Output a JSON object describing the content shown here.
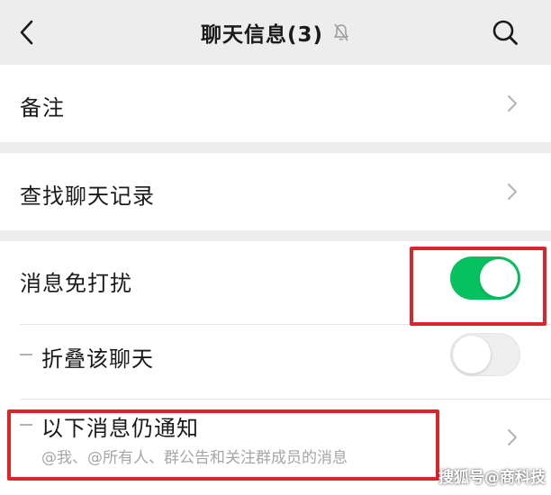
{
  "header": {
    "title": "聊天信息(3)",
    "back_icon": "chevron-left-icon",
    "mute_icon": "bell-muted-icon",
    "search_icon": "search-icon"
  },
  "rows": {
    "remark": {
      "label": "备注"
    },
    "find_history": {
      "label": "查找聊天记录"
    },
    "do_not_disturb": {
      "label": "消息免打扰",
      "enabled": true
    },
    "fold_chat": {
      "label": "折叠该聊天",
      "enabled": false
    },
    "still_notify": {
      "label": "以下消息仍通知",
      "description": "@我、@所有人、群公告和关注群成员的消息"
    }
  },
  "colors": {
    "toggle_on": "#07c160",
    "highlight_box": "#d9262c",
    "background": "#ededed"
  },
  "watermark": {
    "text": "搜狐号@商科技"
  }
}
